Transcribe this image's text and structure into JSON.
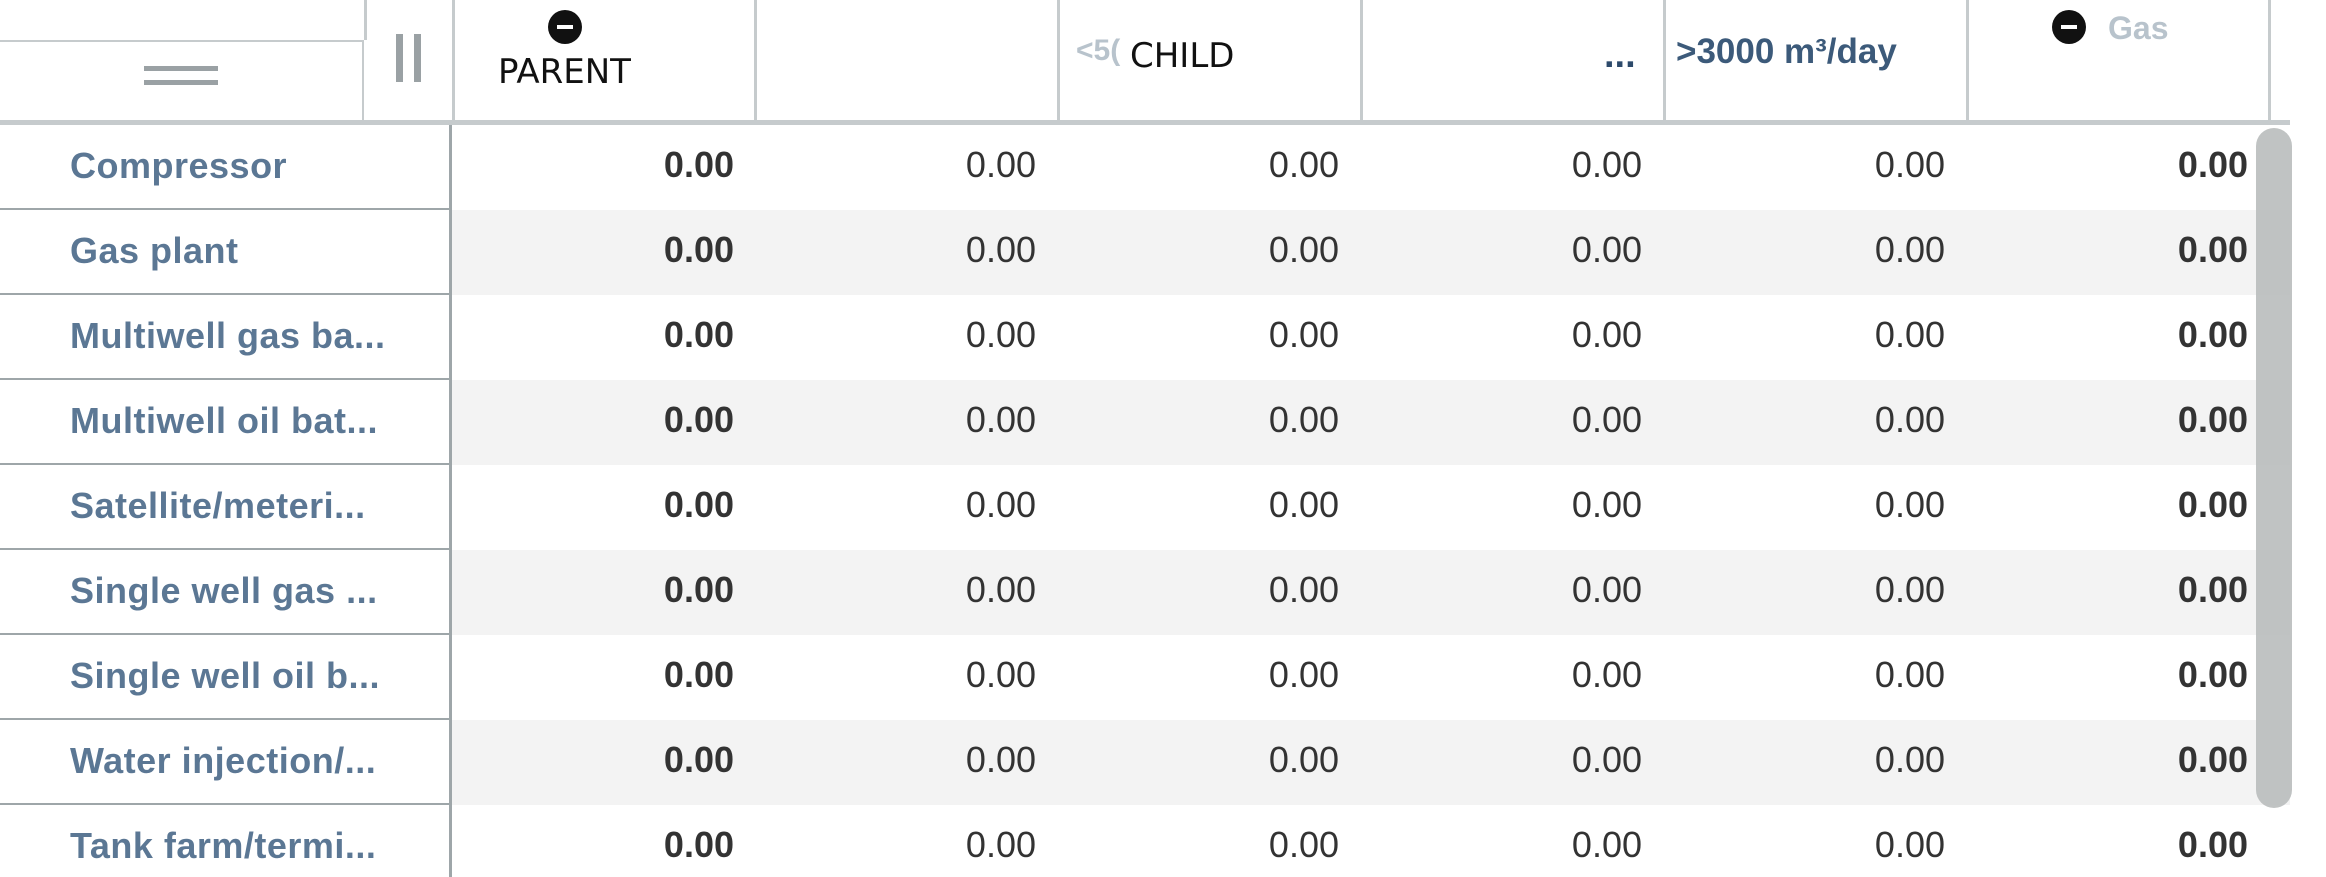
{
  "header": {
    "parent_label": "PARENT",
    "child_label": "CHILD",
    "child_prefix": "<5(",
    "col4_ellipsis": "...",
    "col5_label": ">3000 m³/day",
    "col6_label": "Gas"
  },
  "rows": [
    {
      "label": "Compressor",
      "values": [
        "0.00",
        "0.00",
        "0.00",
        "0.00",
        "0.00",
        "0.00"
      ]
    },
    {
      "label": "Gas plant",
      "values": [
        "0.00",
        "0.00",
        "0.00",
        "0.00",
        "0.00",
        "0.00"
      ]
    },
    {
      "label": "Multiwell gas ba...",
      "values": [
        "0.00",
        "0.00",
        "0.00",
        "0.00",
        "0.00",
        "0.00"
      ]
    },
    {
      "label": "Multiwell oil bat...",
      "values": [
        "0.00",
        "0.00",
        "0.00",
        "0.00",
        "0.00",
        "0.00"
      ]
    },
    {
      "label": "Satellite/meteri...",
      "values": [
        "0.00",
        "0.00",
        "0.00",
        "0.00",
        "0.00",
        "0.00"
      ]
    },
    {
      "label": "Single well gas ...",
      "values": [
        "0.00",
        "0.00",
        "0.00",
        "0.00",
        "0.00",
        "0.00"
      ]
    },
    {
      "label": "Single well oil b...",
      "values": [
        "0.00",
        "0.00",
        "0.00",
        "0.00",
        "0.00",
        "0.00"
      ]
    },
    {
      "label": "Water injection/...",
      "values": [
        "0.00",
        "0.00",
        "0.00",
        "0.00",
        "0.00",
        "0.00"
      ]
    },
    {
      "label": "Tank farm/termi...",
      "values": [
        "0.00",
        "0.00",
        "0.00",
        "0.00",
        "0.00",
        "0.00"
      ]
    }
  ],
  "icons": {
    "menu": "hamburger-icon",
    "resize": "column-resize-handle-icon",
    "collapse": "minus-circle-icon"
  },
  "colors": {
    "grid_line": "#c6cbcd",
    "row_label_text": "#5b7794",
    "header_blue": "#3c5a7a",
    "alt_row_bg": "#f3f3f3",
    "scrollbar": "#b9bcbd"
  }
}
